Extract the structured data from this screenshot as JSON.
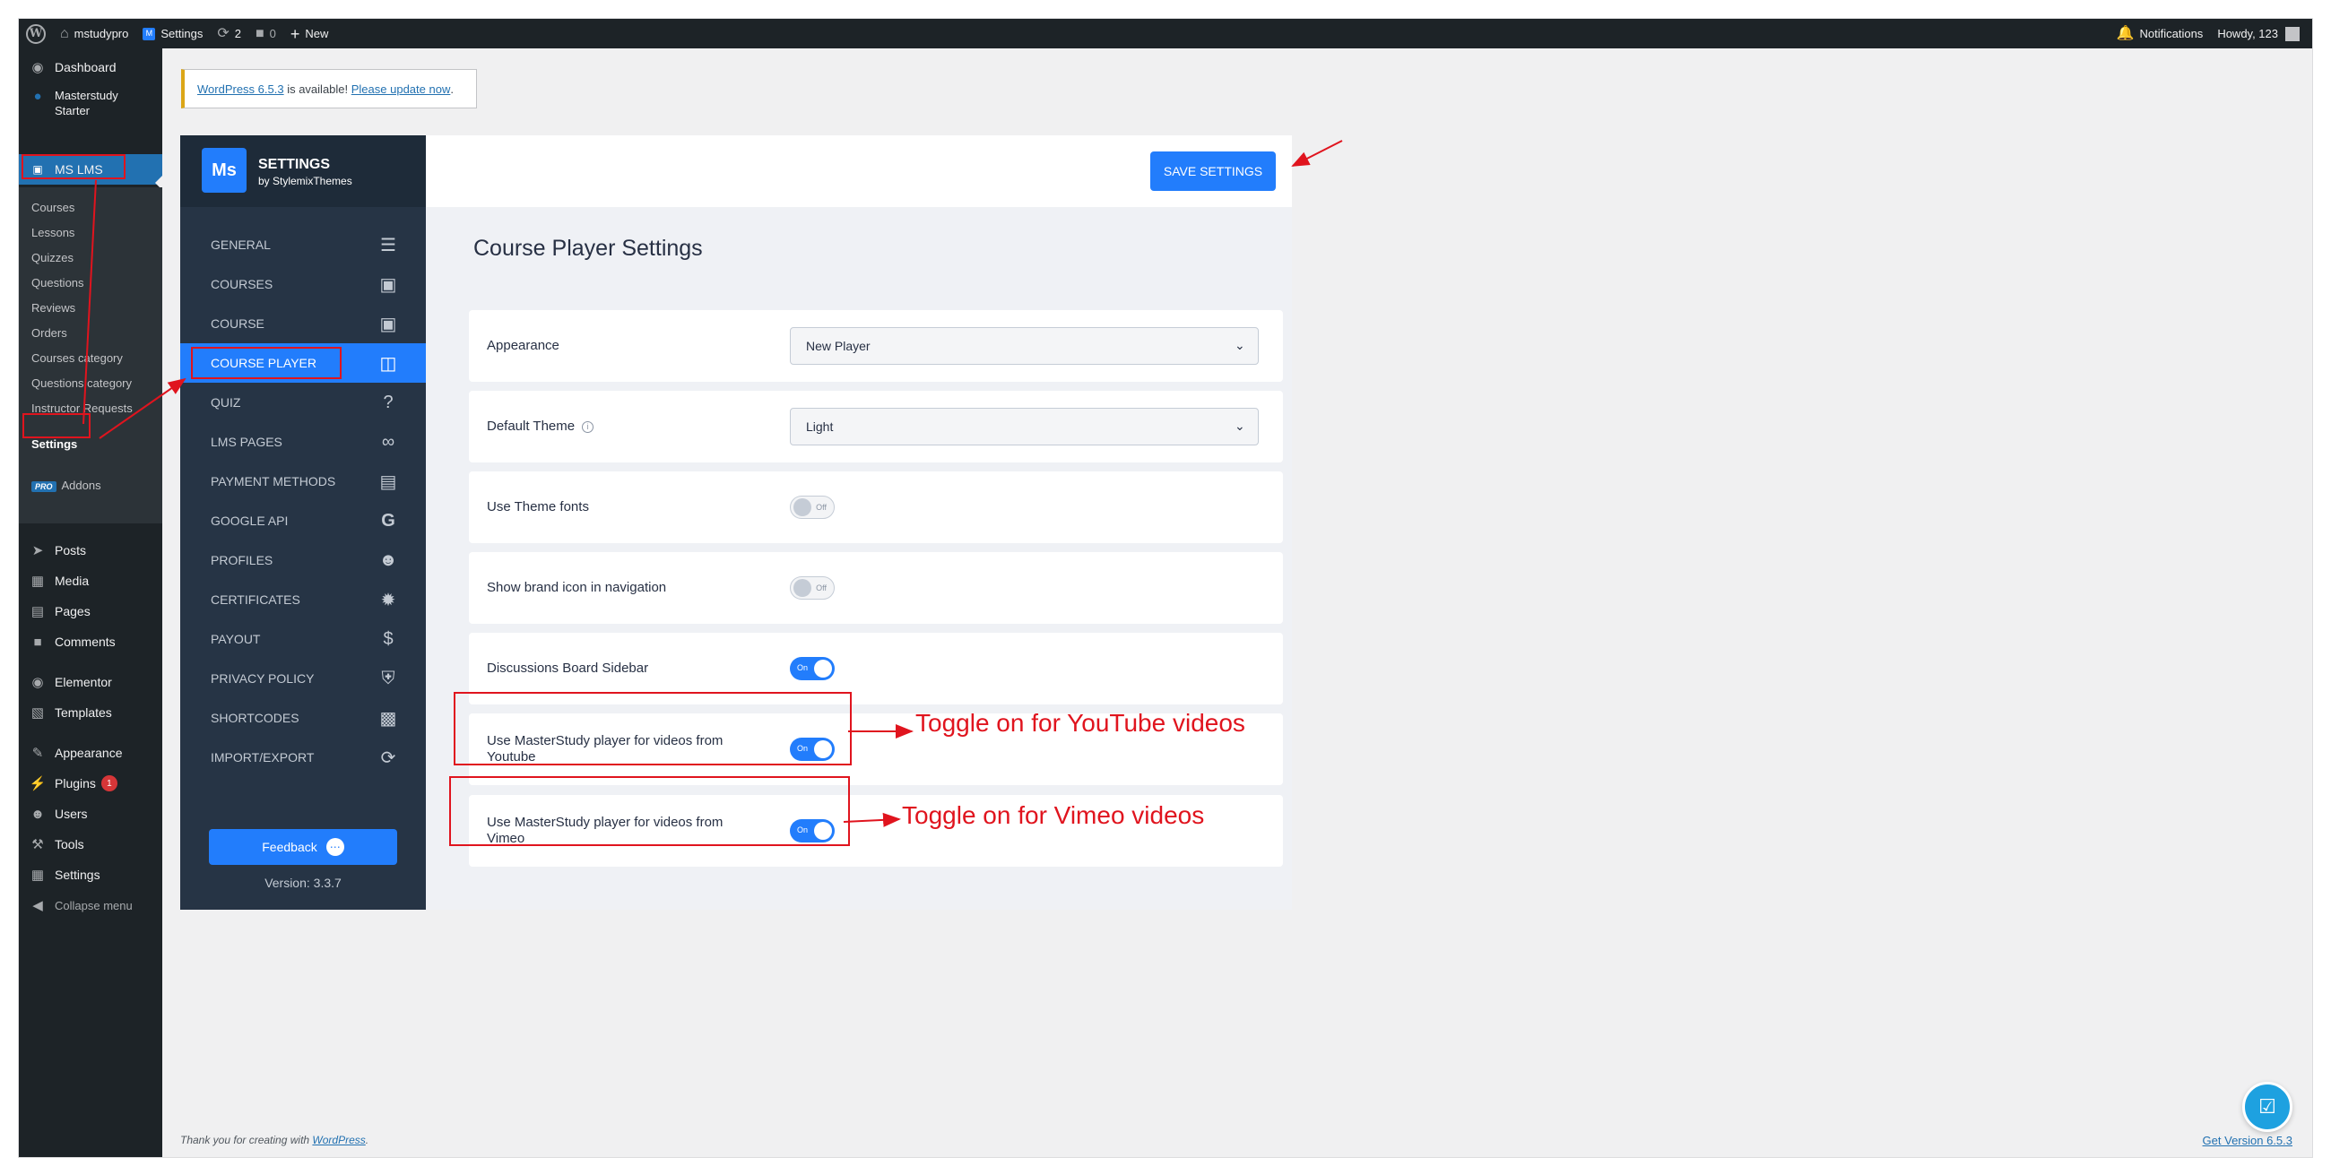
{
  "adminbar": {
    "site_name": "mstudypro",
    "settings_label": "Settings",
    "updates_count": "2",
    "comments_count": "0",
    "new_label": "New",
    "notifications_label": "Notifications",
    "howdy": "Howdy, 123"
  },
  "sidebar": {
    "dashboard": "Dashboard",
    "masterstudy_starter_1": "Masterstudy",
    "masterstudy_starter_2": "Starter",
    "ms_lms": "MS LMS",
    "submenu": [
      "Courses",
      "Lessons",
      "Quizzes",
      "Questions",
      "Reviews",
      "Orders",
      "Courses category",
      "Questions category",
      "Instructor Requests",
      "Settings"
    ],
    "pro_badge": "PRO",
    "addons": "Addons",
    "posts": "Posts",
    "media": "Media",
    "pages": "Pages",
    "comments": "Comments",
    "elementor": "Elementor",
    "templates": "Templates",
    "appearance": "Appearance",
    "plugins": "Plugins",
    "plugins_count": "1",
    "users": "Users",
    "tools": "Tools",
    "settings": "Settings",
    "collapse": "Collapse menu"
  },
  "notice": {
    "version_link": "WordPress 6.5.3",
    "middle": " is available! ",
    "update_link": "Please update now",
    "end": "."
  },
  "ms": {
    "logo": "Ms",
    "title": "SETTINGS",
    "subtitle": "by StylemixThemes",
    "nav": [
      "GENERAL",
      "COURSES",
      "COURSE",
      "COURSE PLAYER",
      "QUIZ",
      "LMS PAGES",
      "PAYMENT METHODS",
      "GOOGLE API",
      "PROFILES",
      "CERTIFICATES",
      "PAYOUT",
      "PRIVACY POLICY",
      "SHORTCODES",
      "IMPORT/EXPORT"
    ],
    "feedback": "Feedback",
    "version": "Version: 3.3.7",
    "save": "SAVE SETTINGS"
  },
  "content": {
    "title": "Course Player Settings",
    "appearance_label": "Appearance",
    "appearance_value": "New Player",
    "theme_label": "Default Theme",
    "theme_value": "Light",
    "theme_fonts_label": "Use Theme fonts",
    "brand_icon_label": "Show brand icon in navigation",
    "discussions_label": "Discussions Board Sidebar",
    "youtube_label": "Use MasterStudy player for videos from Youtube",
    "vimeo_label": "Use MasterStudy player for videos from Vimeo",
    "on": "On",
    "off": "Off"
  },
  "annotations": {
    "youtube": "Toggle on for YouTube videos",
    "vimeo": "Toggle on for Vimeo videos"
  },
  "footer": {
    "thanks": "Thank you for creating with ",
    "wordpress": "WordPress",
    "period": ".",
    "get_version": "Get Version 6.5.3"
  },
  "colors": {
    "accent": "#227dfc",
    "wp_admin_bg": "#1d2327",
    "annotation": "#e0141e"
  }
}
